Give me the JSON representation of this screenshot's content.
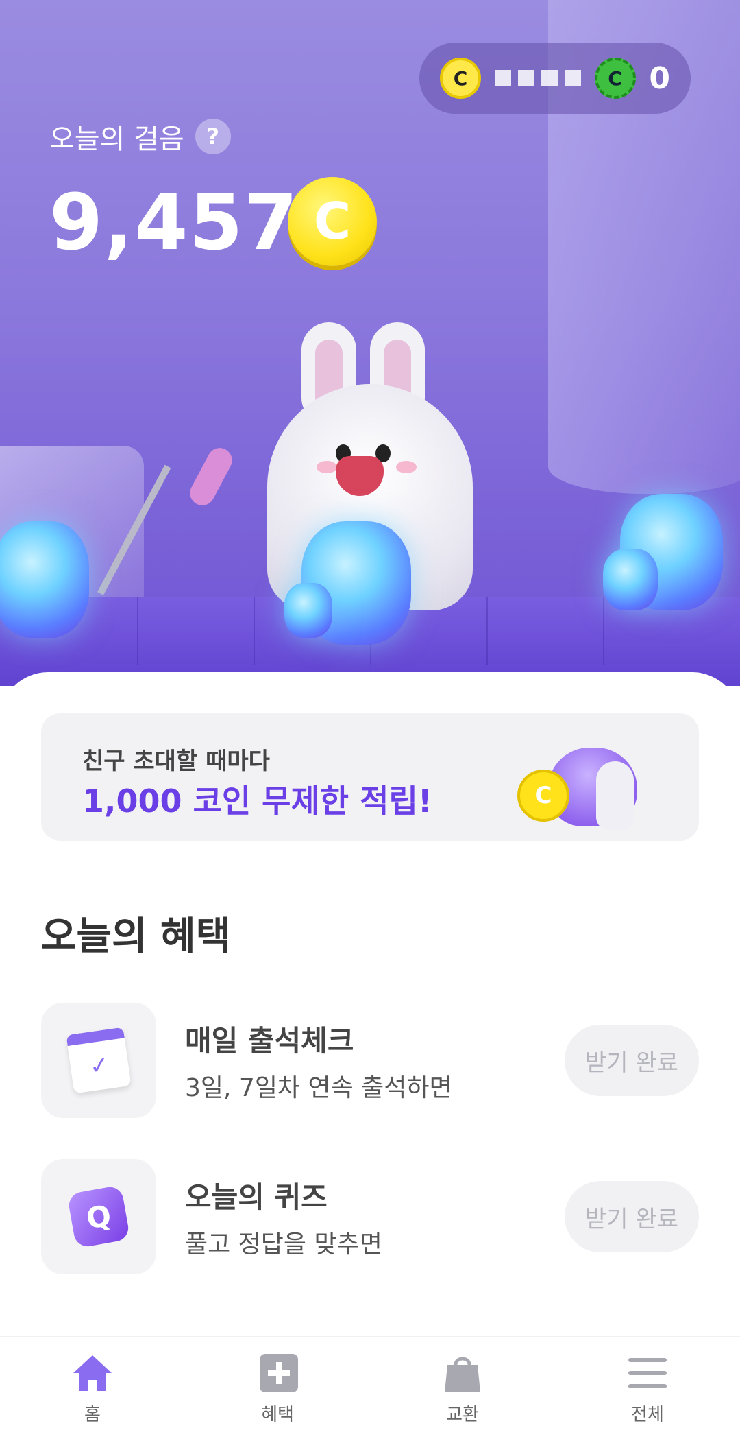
{
  "wallet": {
    "coin_icon_1": "C",
    "coin_icon_2": "C",
    "count": "0"
  },
  "steps": {
    "label": "오늘의 걸음",
    "help": "?",
    "value": "9,457",
    "coin": "C"
  },
  "banner": {
    "line1": "친구 초대할 때마다",
    "line2": "1,000 코인 무제한 적립!",
    "coin": "C"
  },
  "section": {
    "title": "오늘의 혜택"
  },
  "benefits": [
    {
      "icon": "calendar-check-icon",
      "title": "매일 출석체크",
      "desc": "3일, 7일차 연속 출석하면",
      "button": "받기 완료"
    },
    {
      "icon": "quiz-cube-icon",
      "icon_text": "Q",
      "title": "오늘의 퀴즈",
      "desc": "풀고 정답을 맞추면",
      "button": "받기 완료"
    }
  ],
  "tabs": [
    {
      "label": "홈",
      "icon": "home-icon",
      "active": true
    },
    {
      "label": "혜택",
      "icon": "plus-square-icon",
      "active": false
    },
    {
      "label": "교환",
      "icon": "shopping-bag-icon",
      "active": false
    },
    {
      "label": "전체",
      "icon": "menu-icon",
      "active": false
    }
  ],
  "colors": {
    "accent": "#6a40e6",
    "active_tab": "#8a6cf0",
    "inactive_tab": "#a8a8b0"
  }
}
